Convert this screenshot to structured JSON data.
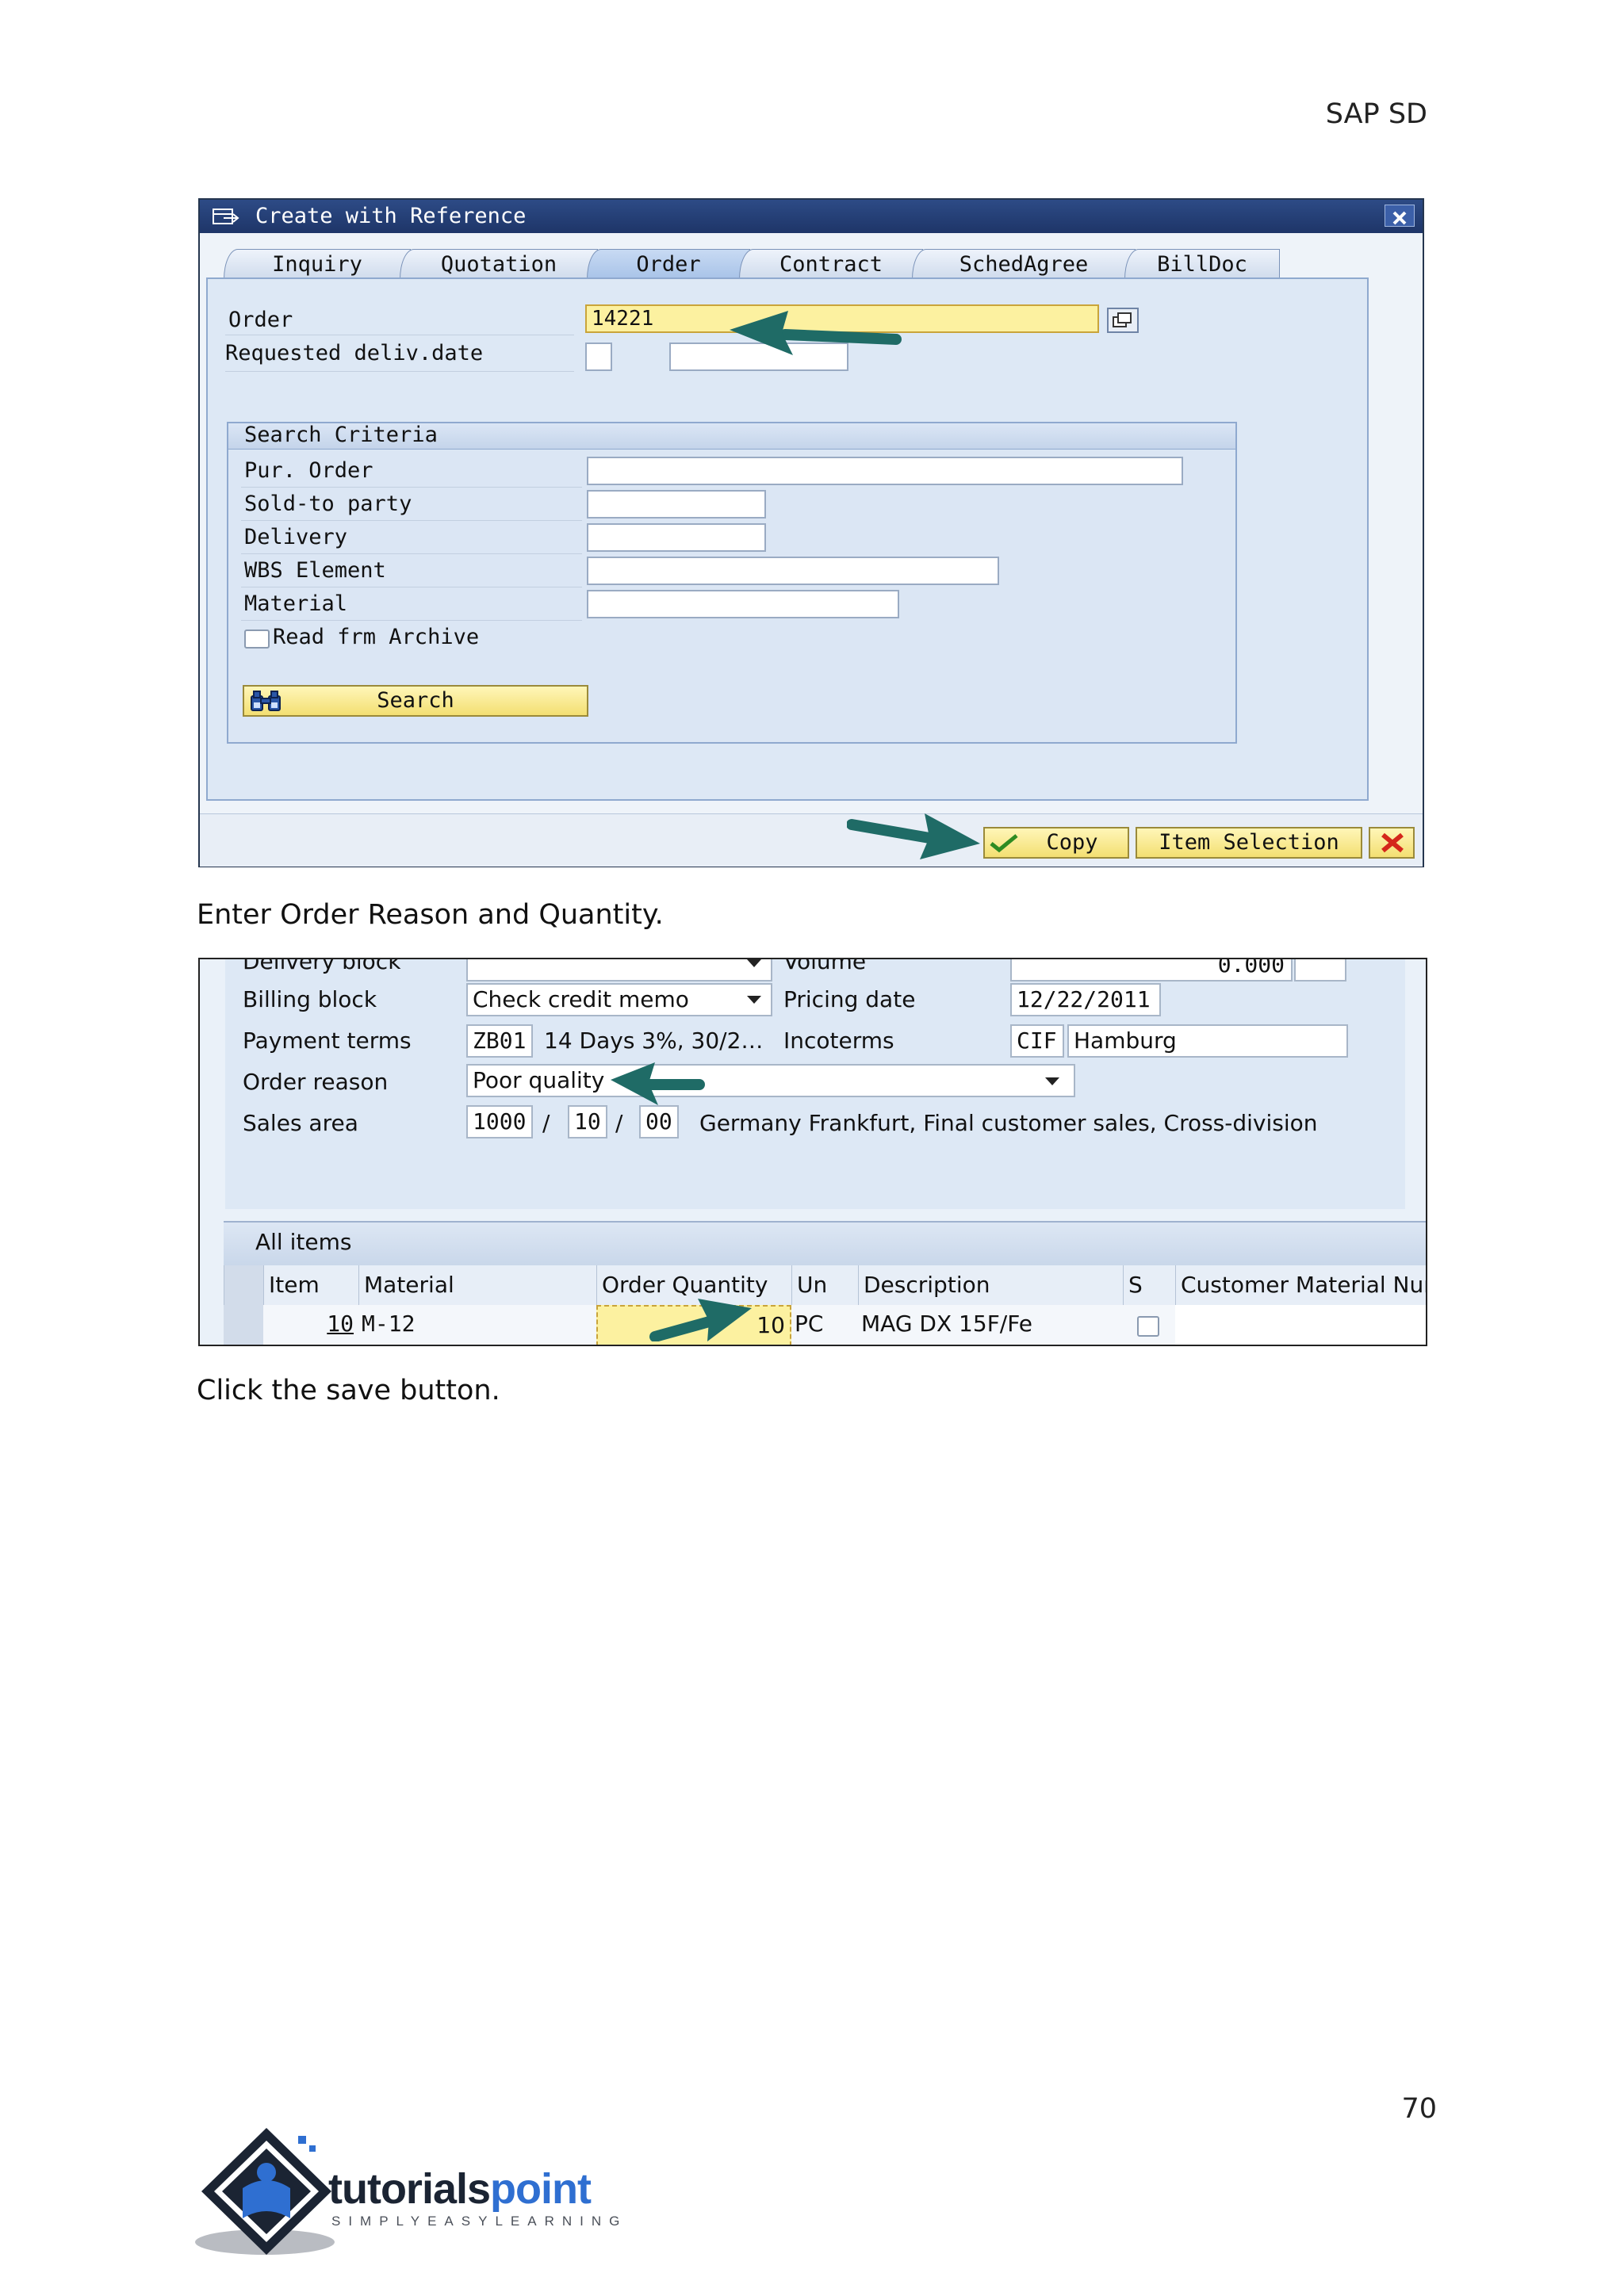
{
  "header": {
    "text": "SAP SD"
  },
  "dialog1": {
    "title": "Create with Reference",
    "tabs": [
      "Inquiry",
      "Quotation",
      "Order",
      "Contract",
      "SchedAgree",
      "BillDoc"
    ],
    "active_tab": "Order",
    "order_label": "Order",
    "order_value": "14221",
    "req_deliv_label": "Requested deliv.date",
    "search_criteria_title": "Search Criteria",
    "criteria": [
      "Pur. Order",
      "Sold-to party",
      "Delivery",
      "WBS Element",
      "Material"
    ],
    "archive_label": "Read frm Archive",
    "search_button": "Search",
    "copy_button": "Copy",
    "item_selection_button": "Item Selection"
  },
  "caption1": "Enter Order Reason and Quantity.",
  "dialog2": {
    "delivery_block_label": "Delivery block",
    "volume_label": "Volume",
    "volume_value": "0.000",
    "billing_block_label": "Billing block",
    "billing_block_value": "Check credit memo",
    "pricing_date_label": "Pricing date",
    "pricing_date_value": "12/22/2011",
    "payment_terms_label": "Payment terms",
    "payment_terms_code": "ZB01",
    "payment_terms_text": "14 Days 3%, 30/2…",
    "incoterms_label": "Incoterms",
    "incoterms_code": "CIF",
    "incoterms_place": "Hamburg",
    "order_reason_label": "Order reason",
    "order_reason_value": "Poor quality",
    "sales_area_label": "Sales area",
    "sales_org": "1000",
    "dist_channel": "10",
    "division": "00",
    "sep": "/",
    "sales_area_text": "Germany Frankfurt, Final customer sales, Cross-division",
    "all_items_label": "All items",
    "columns": [
      "Item",
      "Material",
      "Order Quantity",
      "Un",
      "Description",
      "S",
      "Customer Material Nur"
    ],
    "row": {
      "item": "10",
      "material": "M-12",
      "quantity": "10",
      "unit": "PC",
      "description": "MAG DX 15F/Fe"
    }
  },
  "caption2": "Click the save button.",
  "page_number": "70",
  "logo": {
    "name": "tutorialspoint",
    "tagline": "SIMPLYEASYLEARNING"
  },
  "colors": {
    "accent_arrow": "#1f6b66",
    "sap_title": "#1e3568",
    "field_yellow": "#fcf1a0"
  }
}
